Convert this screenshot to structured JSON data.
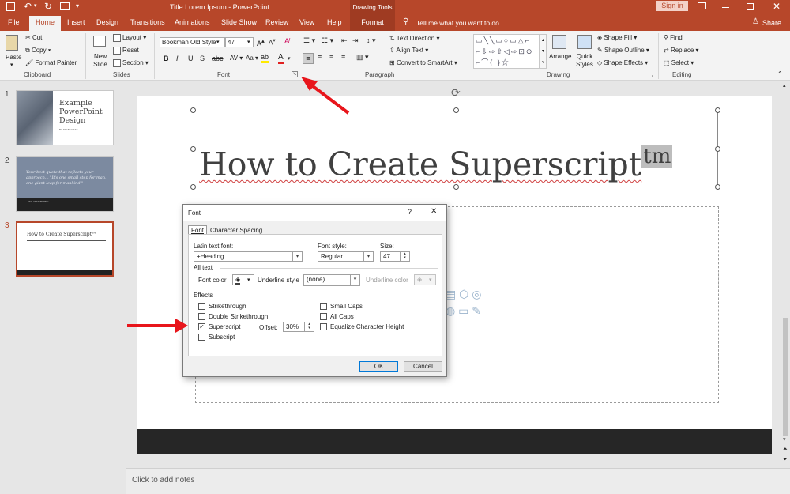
{
  "window": {
    "title": "Title Lorem Ipsum  -  PowerPoint",
    "contextual_group": "Drawing Tools",
    "sign_in": "Sign in",
    "share": "Share",
    "tell_me": "Tell me what you want to do",
    "accent": "#b7472a"
  },
  "tabs": [
    "File",
    "Home",
    "Insert",
    "Design",
    "Transitions",
    "Animations",
    "Slide Show",
    "Review",
    "View",
    "Help",
    "Format"
  ],
  "ribbon": {
    "clipboard": {
      "paste": "Paste",
      "cut": "Cut",
      "copy": "Copy",
      "format_painter": "Format Painter",
      "label": "Clipboard"
    },
    "slides": {
      "new_slide": "New Slide",
      "layout": "Layout",
      "reset": "Reset",
      "section": "Section",
      "label": "Slides"
    },
    "font": {
      "font_name": "Bookman Old Style",
      "font_size": "47",
      "label": "Font"
    },
    "paragraph": {
      "text_direction": "Text Direction",
      "align_text": "Align Text",
      "convert_smartart": "Convert to SmartArt",
      "label": "Paragraph"
    },
    "drawing": {
      "arrange": "Arrange",
      "quick_styles": "Quick Styles",
      "shape_fill": "Shape Fill",
      "shape_outline": "Shape Outline",
      "shape_effects": "Shape Effects",
      "label": "Drawing"
    },
    "editing": {
      "find": "Find",
      "replace": "Replace",
      "select": "Select",
      "label": "Editing"
    }
  },
  "thumbnails": [
    {
      "num": "1",
      "title": "Example PowerPoint Design",
      "byline": "BY DELBY DASS"
    },
    {
      "num": "2",
      "quote": "Your best quote that reflects your approach... \"It's one small step for man, one giant leap for mankind.\"",
      "author": "- NEIL ARMSTRONG"
    },
    {
      "num": "3",
      "title": "How to Create Superscript™"
    }
  ],
  "slide": {
    "title_text": "How to Create Superscript",
    "superscript": "tm"
  },
  "notes": {
    "placeholder": "Click to add notes"
  },
  "dialog": {
    "title": "Font",
    "help": "?",
    "close": "✕",
    "tabs": [
      "Font",
      "Character Spacing"
    ],
    "latin_text_font_label": "Latin text font:",
    "latin_text_font_value": "+Heading",
    "font_style_label": "Font style:",
    "font_style_value": "Regular",
    "size_label": "Size:",
    "size_value": "47",
    "all_text_label": "All text",
    "font_color_label": "Font color",
    "underline_style_label": "Underline style",
    "underline_style_value": "(none)",
    "underline_color_label": "Underline color",
    "effects_label": "Effects",
    "effects_left": [
      {
        "label": "Strikethrough",
        "checked": false
      },
      {
        "label": "Double Strikethrough",
        "checked": false
      },
      {
        "label": "Superscript",
        "checked": true
      },
      {
        "label": "Subscript",
        "checked": false
      }
    ],
    "offset_label": "Offset:",
    "offset_value": "30%",
    "effects_right": [
      {
        "label": "Small Caps",
        "checked": false
      },
      {
        "label": "All Caps",
        "checked": false
      },
      {
        "label": "Equalize Character Height",
        "checked": false
      }
    ],
    "ok": "OK",
    "cancel": "Cancel"
  }
}
